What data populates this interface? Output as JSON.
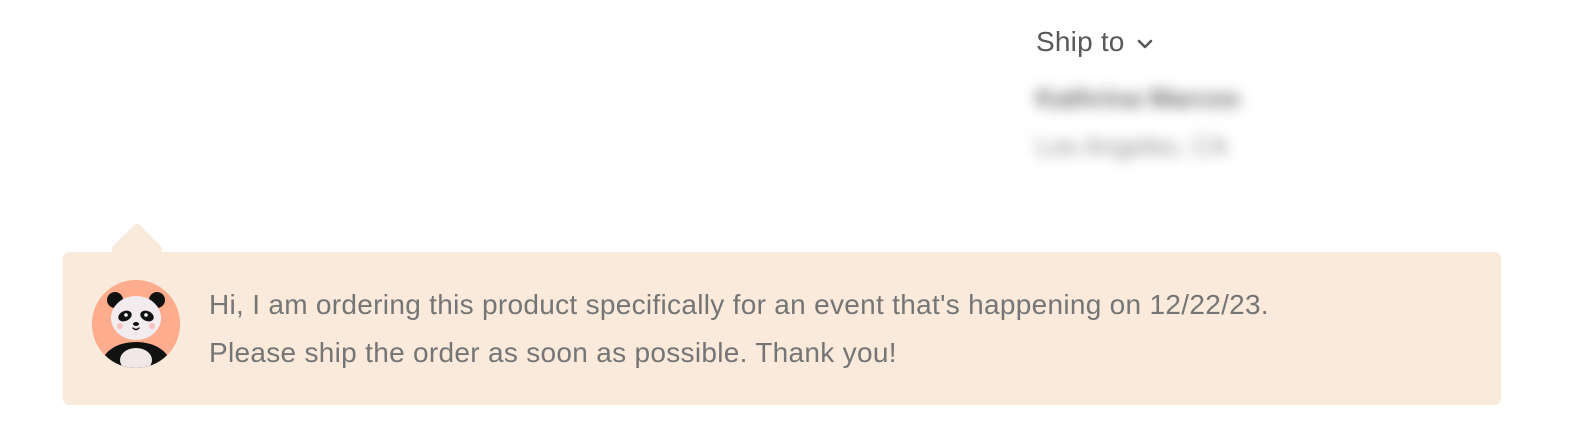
{
  "shipping": {
    "label": "Ship to",
    "chevron_icon": "chevron-down-icon",
    "recipient_name": "Kathrina Marcos",
    "recipient_location": "Los Angeles, CA"
  },
  "note": {
    "avatar_icon": "panda-avatar",
    "lines": [
      "Hi, I am ordering this product specifically for an event that's happening on 12/22/23.",
      "Please ship the order as soon as possible. Thank you!"
    ]
  },
  "colors": {
    "note_background": "#faeadb",
    "avatar_background": "#fdad8d",
    "text_primary": "#595959",
    "text_note": "#757575"
  }
}
